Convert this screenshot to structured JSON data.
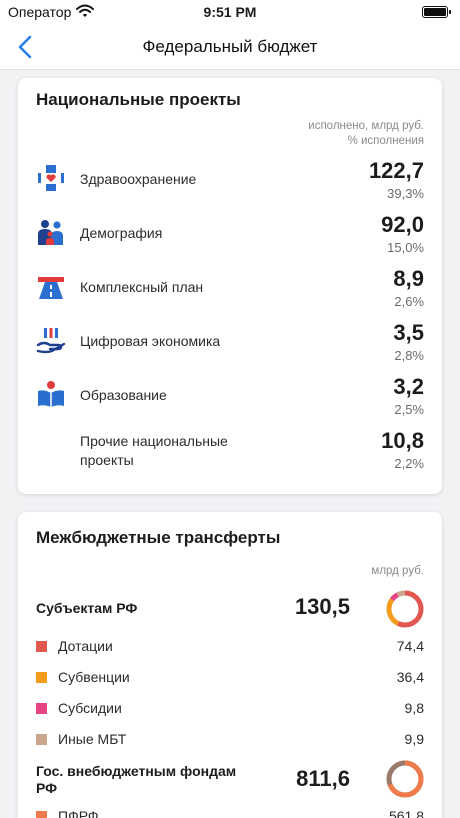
{
  "status_bar": {
    "carrier": "Оператор",
    "time": "9:51 PM"
  },
  "nav": {
    "title": "Федеральный бюджет"
  },
  "projects": {
    "title": "Национальные проекты",
    "header_line1": "исполнено, млрд руб.",
    "header_line2": "% исполнения",
    "items": [
      {
        "name": "Здравоохранение",
        "value": "122,7",
        "pct": "39,3%",
        "icon": "healthcare-icon"
      },
      {
        "name": "Демография",
        "value": "92,0",
        "pct": "15,0%",
        "icon": "demography-icon"
      },
      {
        "name": "Комплексный план",
        "value": "8,9",
        "pct": "2,6%",
        "icon": "road-icon"
      },
      {
        "name": "Цифровая экономика",
        "value": "3,5",
        "pct": "2,8%",
        "icon": "digital-economy-icon"
      },
      {
        "name": "Образование",
        "value": "3,2",
        "pct": "2,5%",
        "icon": "education-icon"
      },
      {
        "name_line1": "Прочие национальные",
        "name_line2": "проекты",
        "value": "10,8",
        "pct": "2,2%"
      }
    ]
  },
  "transfers": {
    "title": "Межбюджетные трансферты",
    "unit": "млрд руб.",
    "groups": [
      {
        "name": "Субъектам РФ",
        "value": "130,5",
        "items": [
          {
            "label": "Дотации",
            "value": "74,4",
            "color": "#e0584f"
          },
          {
            "label": "Субвенции",
            "value": "36,4",
            "color": "#f29b1f"
          },
          {
            "label": "Субсидии",
            "value": "9,8",
            "color": "#e54486"
          },
          {
            "label": "Иные МБТ",
            "value": "9,9",
            "color": "#c9a68c"
          }
        ]
      },
      {
        "name_line1": "Гос. внебюджетным фондам",
        "name_line2": "РФ",
        "value": "811,6",
        "items": [
          {
            "label": "ПФРФ",
            "value": "561,8",
            "color": "#ef7a4c"
          }
        ]
      }
    ]
  }
}
